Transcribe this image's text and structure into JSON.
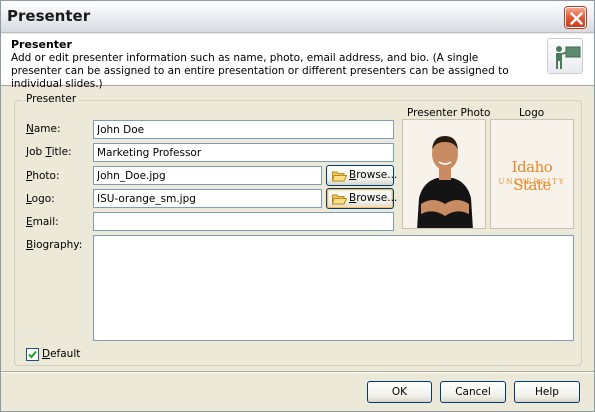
{
  "window": {
    "title": "Presenter"
  },
  "header": {
    "title": "Presenter",
    "description": "Add or edit presenter information such as name, photo, email address, and bio. (A single presenter can be assigned to an entire presentation or different presenters can be assigned to individual slides.)",
    "icon": "presenter-icon"
  },
  "group": {
    "legend": "Presenter"
  },
  "fields": {
    "name": {
      "label_key": "N",
      "label_rest": "ame:",
      "value": "John Doe"
    },
    "job_title": {
      "label_pre": "Job ",
      "label_key": "T",
      "label_rest": "itle:",
      "value": "Marketing Professor"
    },
    "photo": {
      "label_key": "P",
      "label_rest": "hoto:",
      "value": "John_Doe.jpg"
    },
    "logo": {
      "label_key": "L",
      "label_rest": "ogo:",
      "value": "ISU-orange_sm.jpg"
    },
    "email": {
      "label_key": "E",
      "label_rest": "mail:",
      "value": ""
    },
    "biography": {
      "label_key": "B",
      "label_rest": "iography:",
      "value": ""
    }
  },
  "buttons": {
    "browse_photo": {
      "key": "B",
      "rest": "rowse..."
    },
    "browse_logo": {
      "key": "B",
      "rest": "rowse..."
    },
    "ok": "OK",
    "cancel": "Cancel",
    "help": "Help"
  },
  "preview": {
    "photo_caption": "Presenter Photo",
    "logo_caption": "Logo",
    "logo_text_line1": "Idaho State",
    "logo_text_line2": "UNIVERSITY"
  },
  "default_option": {
    "label_key": "D",
    "label_rest": "efault",
    "checked": true
  },
  "colors": {
    "close_button": "#e25a34",
    "logo_orange": "#e88a2a",
    "field_border": "#7f9db9"
  }
}
